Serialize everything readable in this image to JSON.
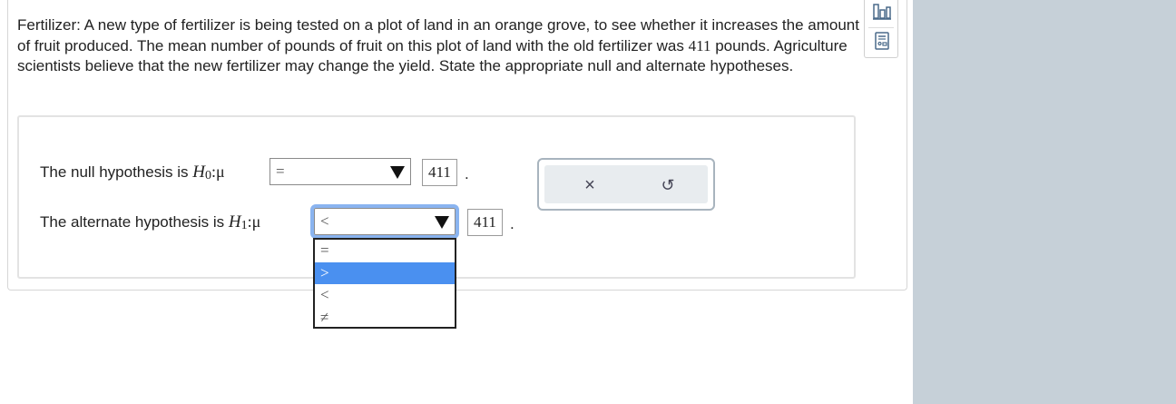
{
  "question": {
    "prefix": "Fertilizer: A new type of fertilizer is being tested on a plot of land in an orange grove, to see whether it increases the amount of fruit produced. The mean number of pounds of fruit on this plot of land with the old fertilizer was ",
    "value": "411",
    "suffix": " pounds. Agriculture scientists believe that the new fertilizer may change the yield. State the appropriate null and alternate hypotheses."
  },
  "null_row": {
    "label": "The null hypothesis is ",
    "symbol": "H",
    "subscript": "0",
    "colon_mu": ":μ",
    "selected": "=",
    "value": "411",
    "period": "."
  },
  "alt_row": {
    "label": "The alternate hypothesis is ",
    "symbol": "H",
    "subscript": "1",
    "colon_mu": ":μ",
    "selected": "<",
    "value": "411",
    "period": "."
  },
  "dropdown": {
    "options": [
      "=",
      ">",
      "<",
      "≠"
    ],
    "highlighted": ">"
  },
  "actions": {
    "clear": "×",
    "undo": "↺"
  },
  "colors": {
    "accent": "#4a90f0",
    "focus_ring": "#8ab4f0",
    "right_panel": "#c6d0d8"
  }
}
